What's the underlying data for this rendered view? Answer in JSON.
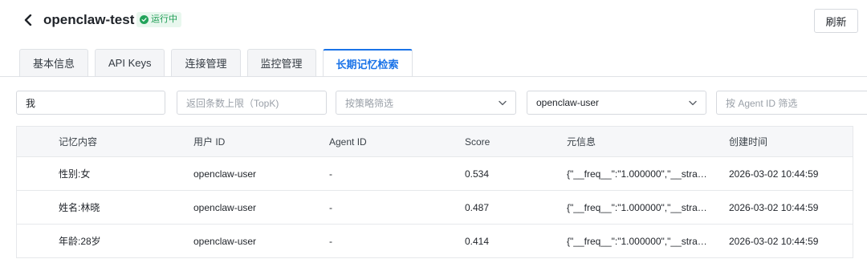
{
  "header": {
    "title": "openclaw-test",
    "status": "运行中",
    "refresh_label": "刷新"
  },
  "tabs": [
    {
      "label": "基本信息",
      "active": false
    },
    {
      "label": "API Keys",
      "active": false
    },
    {
      "label": "连接管理",
      "active": false
    },
    {
      "label": "监控管理",
      "active": false
    },
    {
      "label": "长期记忆检索",
      "active": true
    }
  ],
  "filters": {
    "query_value": "我",
    "topk_placeholder": "返回条数上限（TopK)",
    "strategy_placeholder": "按策略筛选",
    "user_selected": "openclaw-user",
    "agent_placeholder": "按 Agent ID 筛选"
  },
  "table": {
    "columns": [
      "记忆内容",
      "用户 ID",
      "Agent ID",
      "Score",
      "元信息",
      "创建时间"
    ],
    "rows": [
      {
        "content": "性别:女",
        "user_id": "openclaw-user",
        "agent_id": "-",
        "score": "0.534",
        "meta": "{\"__freq__\":\"1.000000\",\"__strat…",
        "created": "2026-03-02 10:44:59"
      },
      {
        "content": "姓名:林晓",
        "user_id": "openclaw-user",
        "agent_id": "-",
        "score": "0.487",
        "meta": "{\"__freq__\":\"1.000000\",\"__strat…",
        "created": "2026-03-02 10:44:59"
      },
      {
        "content": "年龄:28岁",
        "user_id": "openclaw-user",
        "agent_id": "-",
        "score": "0.414",
        "meta": "{\"__freq__\":\"1.000000\",\"__strat…",
        "created": "2026-03-02 10:44:59"
      }
    ]
  },
  "colors": {
    "accent": "#1a73e8",
    "status_green": "#22a35a"
  }
}
